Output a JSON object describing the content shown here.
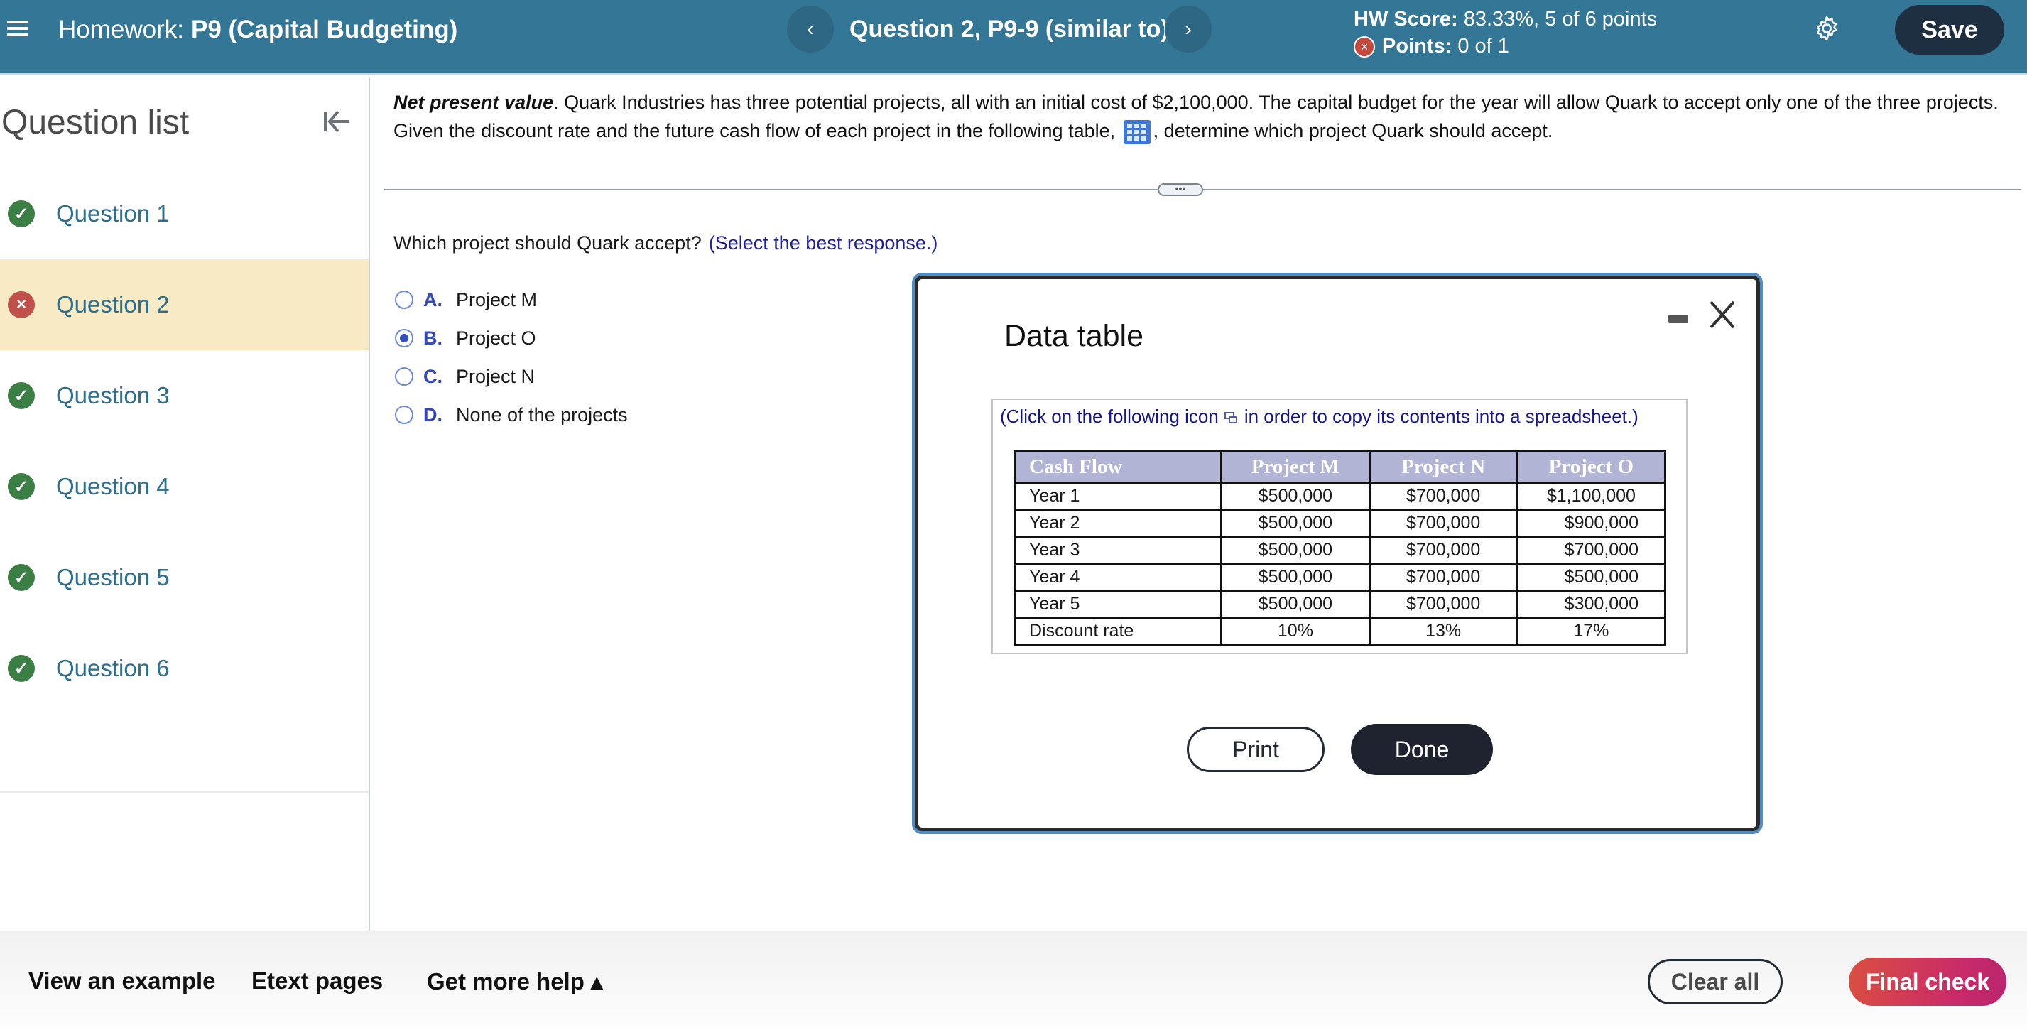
{
  "header": {
    "menu_icon": "hamburger-menu-icon",
    "homework_label": "Homework:",
    "homework_name": "P9 (Capital Budgeting)",
    "prev_icon": "‹",
    "next_icon": "›",
    "question_title": "Question 2, P9-9 (similar to)",
    "hw_score_label": "HW Score:",
    "hw_score_value": "83.33%, 5 of 6 points",
    "points_label": "Points:",
    "points_value": "0 of 1",
    "points_status_icon": "×",
    "save_label": "Save"
  },
  "sidebar": {
    "title": "Question list",
    "items": [
      {
        "label": "Question 1",
        "status": "correct",
        "icon": "✓"
      },
      {
        "label": "Question 2",
        "status": "incorrect",
        "icon": "×",
        "active": true
      },
      {
        "label": "Question 3",
        "status": "correct",
        "icon": "✓"
      },
      {
        "label": "Question 4",
        "status": "correct",
        "icon": "✓"
      },
      {
        "label": "Question 5",
        "status": "correct",
        "icon": "✓"
      },
      {
        "label": "Question 6",
        "status": "correct",
        "icon": "✓"
      }
    ]
  },
  "main": {
    "prompt_term": "Net present value",
    "prompt_part1": ". Quark Industries has three potential projects, all with an initial cost of $2,100,000. The capital budget for the year will allow Quark to accept only one of the three projects. Given the discount rate and the future cash flow of each project in the following table,",
    "prompt_part2": ", determine which project Quark should accept.",
    "divider_handle": "•••",
    "question": "Which project should Quark accept?",
    "question_hint": "(Select the best response.)",
    "options": [
      {
        "letter": "A.",
        "text": "Project M",
        "selected": false
      },
      {
        "letter": "B.",
        "text": "Project O",
        "selected": true
      },
      {
        "letter": "C.",
        "text": "Project N",
        "selected": false
      },
      {
        "letter": "D.",
        "text": "None of the projects",
        "selected": false
      }
    ]
  },
  "modal": {
    "title": "Data table",
    "copy_note_before": "(Click on the following icon",
    "copy_note_after": "in order to copy its contents into a spreadsheet.)",
    "table": {
      "headers": [
        "Cash Flow",
        "Project M",
        "Project N",
        "Project O"
      ],
      "rows": [
        [
          "Year 1",
          "$500,000",
          "$700,000",
          "$1,100,000"
        ],
        [
          "Year 2",
          "$500,000",
          "$700,000",
          "$900,000"
        ],
        [
          "Year 3",
          "$500,000",
          "$700,000",
          "$700,000"
        ],
        [
          "Year 4",
          "$500,000",
          "$700,000",
          "$500,000"
        ],
        [
          "Year 5",
          "$500,000",
          "$700,000",
          "$300,000"
        ],
        [
          "Discount rate",
          "10%",
          "13%",
          "17%"
        ]
      ]
    },
    "print_label": "Print",
    "done_label": "Done"
  },
  "footer": {
    "view_example": "View an example",
    "etext": "Etext pages",
    "more_help": "Get more help ▴",
    "clear_all": "Clear all",
    "final_check": "Final check"
  }
}
